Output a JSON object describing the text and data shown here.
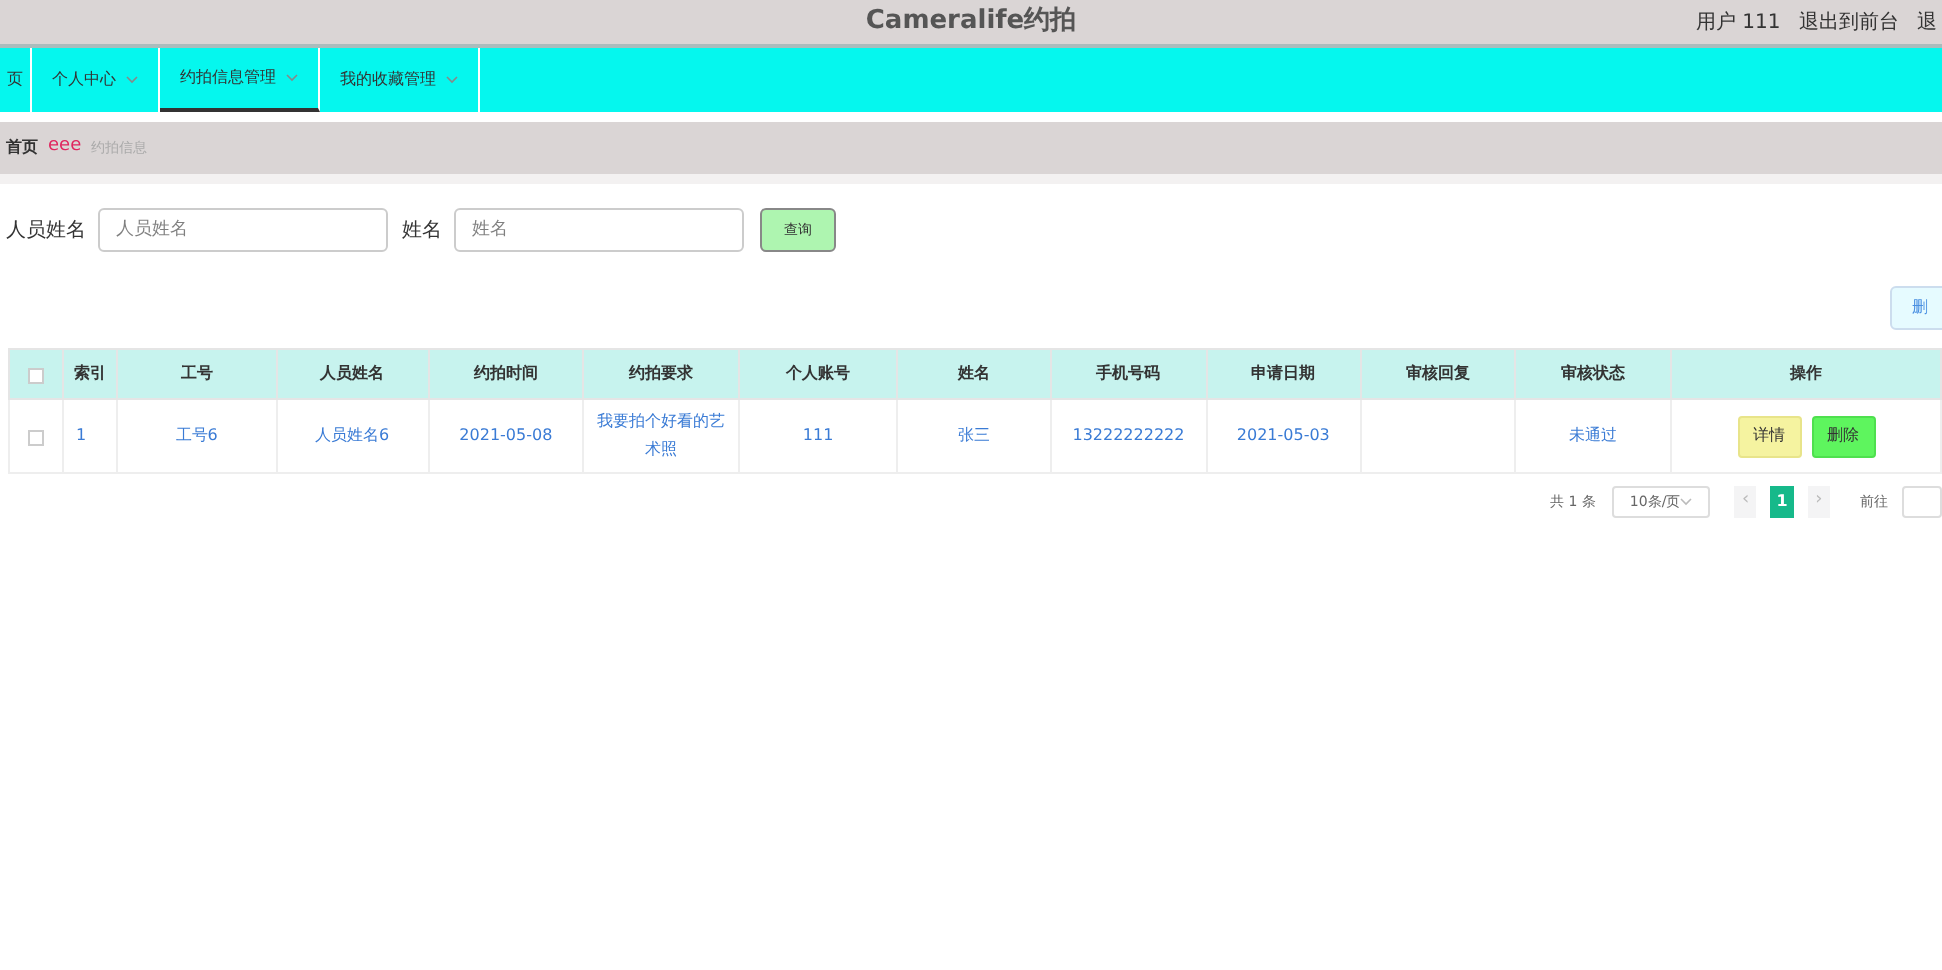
{
  "header": {
    "title": "Cameralife约拍",
    "user": "用户 111",
    "links": [
      "退出到前台",
      "退"
    ]
  },
  "nav": [
    {
      "label": "页",
      "dropdown": false,
      "selected": false
    },
    {
      "label": "个人中心",
      "dropdown": true,
      "selected": false
    },
    {
      "label": "约拍信息管理",
      "dropdown": true,
      "selected": true
    },
    {
      "label": "我的收藏管理",
      "dropdown": true,
      "selected": false
    }
  ],
  "breadcrumb": [
    "首页",
    "eee",
    "约拍信息"
  ],
  "search": {
    "fields": [
      {
        "label": "人员姓名",
        "placeholder": "人员姓名"
      },
      {
        "label": "姓名",
        "placeholder": "姓名"
      }
    ],
    "button": "查询"
  },
  "delete_button": "删",
  "table": {
    "select_all_checked": false,
    "columns": [
      "索引",
      "工号",
      "人员姓名",
      "约拍时间",
      "约拍要求",
      "个人账号",
      "姓名",
      "手机号码",
      "申请日期",
      "审核回复",
      "审核状态",
      "操作"
    ],
    "rows": [
      {
        "checked": false,
        "cells": [
          "1",
          "工号6",
          "人员姓名6",
          "2021-05-08",
          "我要拍个好看的艺术照",
          "111",
          "张三",
          "13222222222",
          "2021-05-03",
          "",
          "未通过"
        ],
        "actions": [
          "详情",
          "删除"
        ]
      }
    ]
  },
  "pagination": {
    "total": "共 1 条",
    "page_size": "10条/页",
    "prev": "‹",
    "pages": [
      {
        "label": "1",
        "selected": true
      }
    ],
    "next": "›",
    "goto": "前往"
  }
}
